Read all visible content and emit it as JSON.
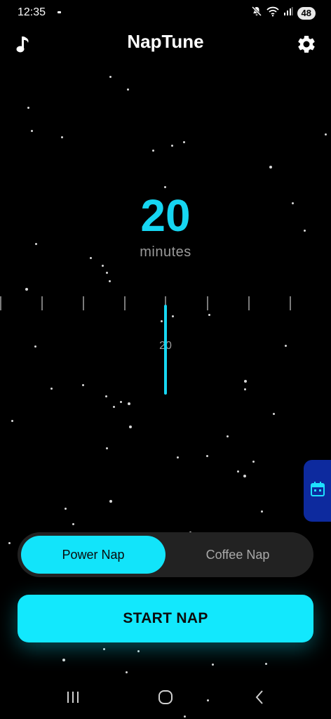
{
  "status_bar": {
    "time": "12:35",
    "battery": "48",
    "icons": [
      "mute-icon",
      "wifi-icon",
      "signal-icon"
    ]
  },
  "app_bar": {
    "title": "NapTune",
    "left_icon": "music-note-icon",
    "right_icon": "gear-icon"
  },
  "duration": {
    "value": "20",
    "unit": "minutes"
  },
  "ruler": {
    "selected_label": "20"
  },
  "side_tab": {
    "icon": "calendar-icon"
  },
  "nap_mode": {
    "options": [
      "Power Nap",
      "Coffee Nap"
    ],
    "selected": "Power Nap"
  },
  "start_button": {
    "label": "START NAP"
  },
  "nav_bar": {
    "items": [
      "recents-icon",
      "home-icon",
      "back-icon"
    ]
  },
  "colors": {
    "accent": "#12e8fd",
    "background": "#000000",
    "toggle_track": "#222222",
    "side_tab": "#0d2a9e"
  }
}
